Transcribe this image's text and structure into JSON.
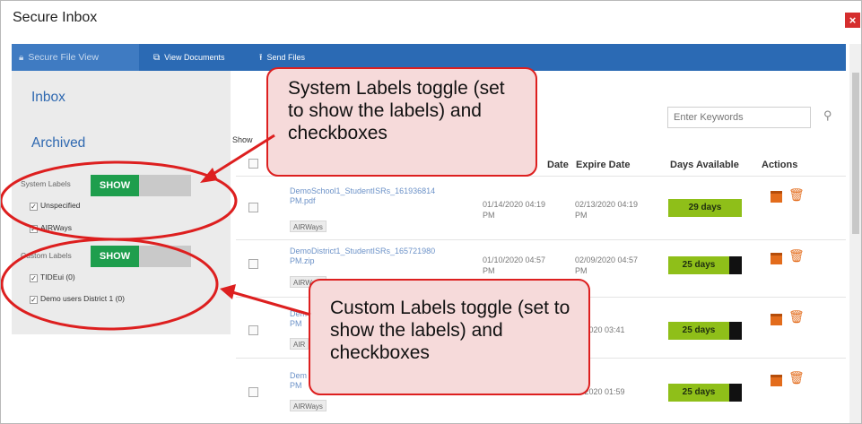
{
  "window": {
    "title": "Secure Inbox",
    "close_label": "×"
  },
  "tabs": [
    {
      "label": "Secure File View",
      "icon": "lock-icon"
    },
    {
      "label": "View Documents",
      "icon": "documents-icon"
    },
    {
      "label": "Send Files",
      "icon": "upload-icon"
    }
  ],
  "sidebar": {
    "inbox": "Inbox",
    "archived": "Archived",
    "system_labels": {
      "heading": "System Labels",
      "toggle": "SHOW",
      "items": [
        {
          "label": "Unspecified",
          "checked": true
        },
        {
          "label": "AIRWays",
          "checked": true
        }
      ]
    },
    "custom_labels": {
      "heading": "Custom Labels",
      "toggle": "SHOW",
      "items": [
        {
          "label": "TIDEui (0)",
          "checked": true
        },
        {
          "label": "Demo users District 1 (0)",
          "checked": true
        }
      ]
    }
  },
  "search": {
    "placeholder": "Enter Keywords"
  },
  "table": {
    "columns": {
      "show": "Show",
      "received": "Date",
      "expire": "Expire Date",
      "days": "Days Available",
      "actions": "Actions"
    },
    "rows": [
      {
        "file": "DemoSchool1_StudentISRs_161936814 PM.pdf",
        "tag": "AIRWays",
        "received": "01/14/2020 04:19 PM",
        "expire": "02/13/2020 04:19 PM",
        "days": "29 days"
      },
      {
        "file": "DemoDistrict1_StudentISRs_165721980 PM.zip",
        "tag": "AIRWays",
        "received": "01/10/2020 04:57 PM",
        "expire": "02/09/2020 04:57 PM",
        "days": "25 days"
      },
      {
        "file": "Dem PM",
        "tag": "AIR",
        "received": "",
        "expire": "9/2020 03:41",
        "days": "25 days"
      },
      {
        "file": "Dem PM",
        "tag": "AIRWays",
        "received": "",
        "expire": "9/2020 01:59",
        "days": "25 days"
      }
    ]
  },
  "callouts": {
    "system": "System Labels toggle (set to show the labels) and checkboxes",
    "custom": "Custom Labels toggle (set to show the labels) and checkboxes"
  },
  "colors": {
    "tabbar": "#2b6ab4",
    "toggle_on": "#1e9e4d",
    "days_badge": "#8fbf19",
    "annotation": "#dd1f1f",
    "callout_fill": "#f6dada"
  }
}
